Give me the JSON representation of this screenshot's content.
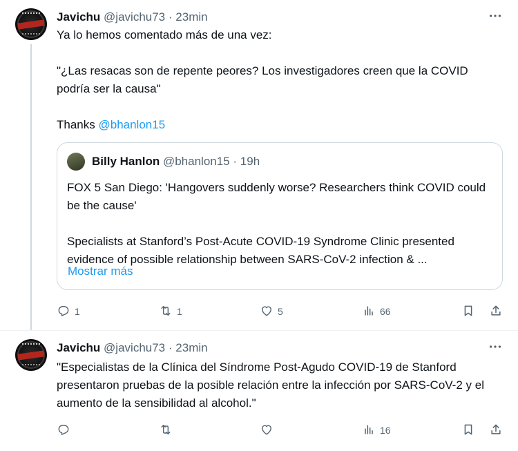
{
  "tweets": [
    {
      "author_name": "Javichu",
      "handle": "@javichu73",
      "separator": "·",
      "time": "23min",
      "text": "Ya lo hemos comentado más de una vez:\n\n\"¿Las resacas son de repente peores? Los investigadores creen que la COVID podría ser la causa\"\n\n",
      "thanks_label": "Thanks ",
      "mention": "@bhanlon15",
      "quote": {
        "author_name": "Billy Hanlon",
        "handle": "@bhanlon15",
        "separator": "·",
        "time": "19h",
        "text": "FOX 5 San Diego: 'Hangovers suddenly worse? Researchers think COVID could be the cause'\n\nSpecialists at Stanford’s Post-Acute COVID-19 Syndrome Clinic presented evidence of possible relationship between SARS-CoV-2 infection & ...",
        "show_more": "Mostrar más"
      },
      "actions": {
        "replies": "1",
        "retweets": "1",
        "likes": "5",
        "views": "66"
      }
    },
    {
      "author_name": "Javichu",
      "handle": "@javichu73",
      "separator": "·",
      "time": "23min",
      "text": "\"Especialistas de la Clínica del Síndrome Post-Agudo COVID-19 de Stanford presentaron pruebas de la posible relación entre la infección por SARS-CoV-2 y el aumento de la sensibilidad al alcohol.\"",
      "actions": {
        "replies": "",
        "retweets": "",
        "likes": "",
        "views": "16"
      }
    }
  ],
  "icons": {
    "reply": "reply-icon",
    "retweet": "retweet-icon",
    "like": "heart-icon",
    "views": "views-chart-icon",
    "bookmark": "bookmark-icon",
    "share": "share-icon",
    "more": "more-dots-icon"
  },
  "colors": {
    "text": "#0f1419",
    "secondary": "#536471",
    "link": "#1d9bf0",
    "border": "#cfd9de"
  }
}
